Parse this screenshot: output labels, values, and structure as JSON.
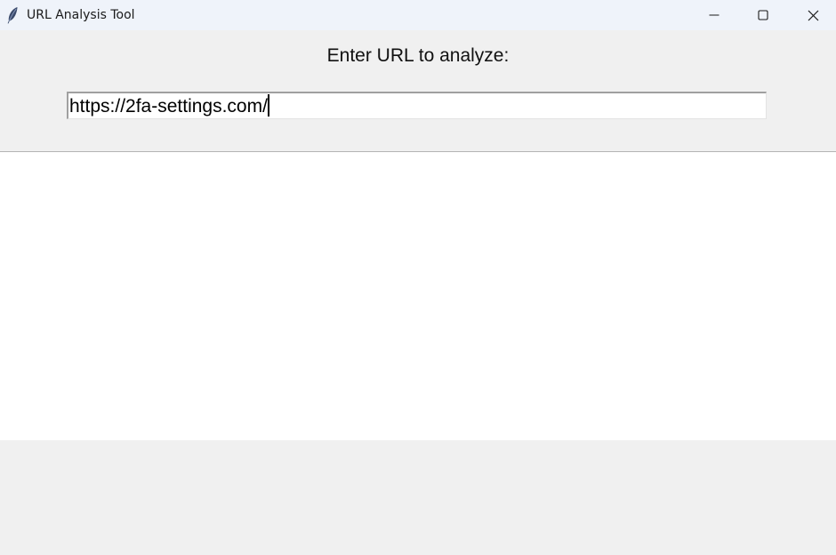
{
  "window": {
    "title": "URL Analysis Tool",
    "icon": "feather-icon",
    "controls": {
      "minimize_icon": "minimize-icon",
      "maximize_icon": "maximize-icon",
      "close_icon": "close-icon"
    }
  },
  "form": {
    "prompt": "Enter URL to analyze:",
    "url_value": "https://2fa-settings.com/"
  },
  "results": {
    "content": ""
  },
  "colors": {
    "titlebar_bg": "#eff3fa",
    "window_bg": "#f0f0f0",
    "results_bg": "#ffffff"
  }
}
